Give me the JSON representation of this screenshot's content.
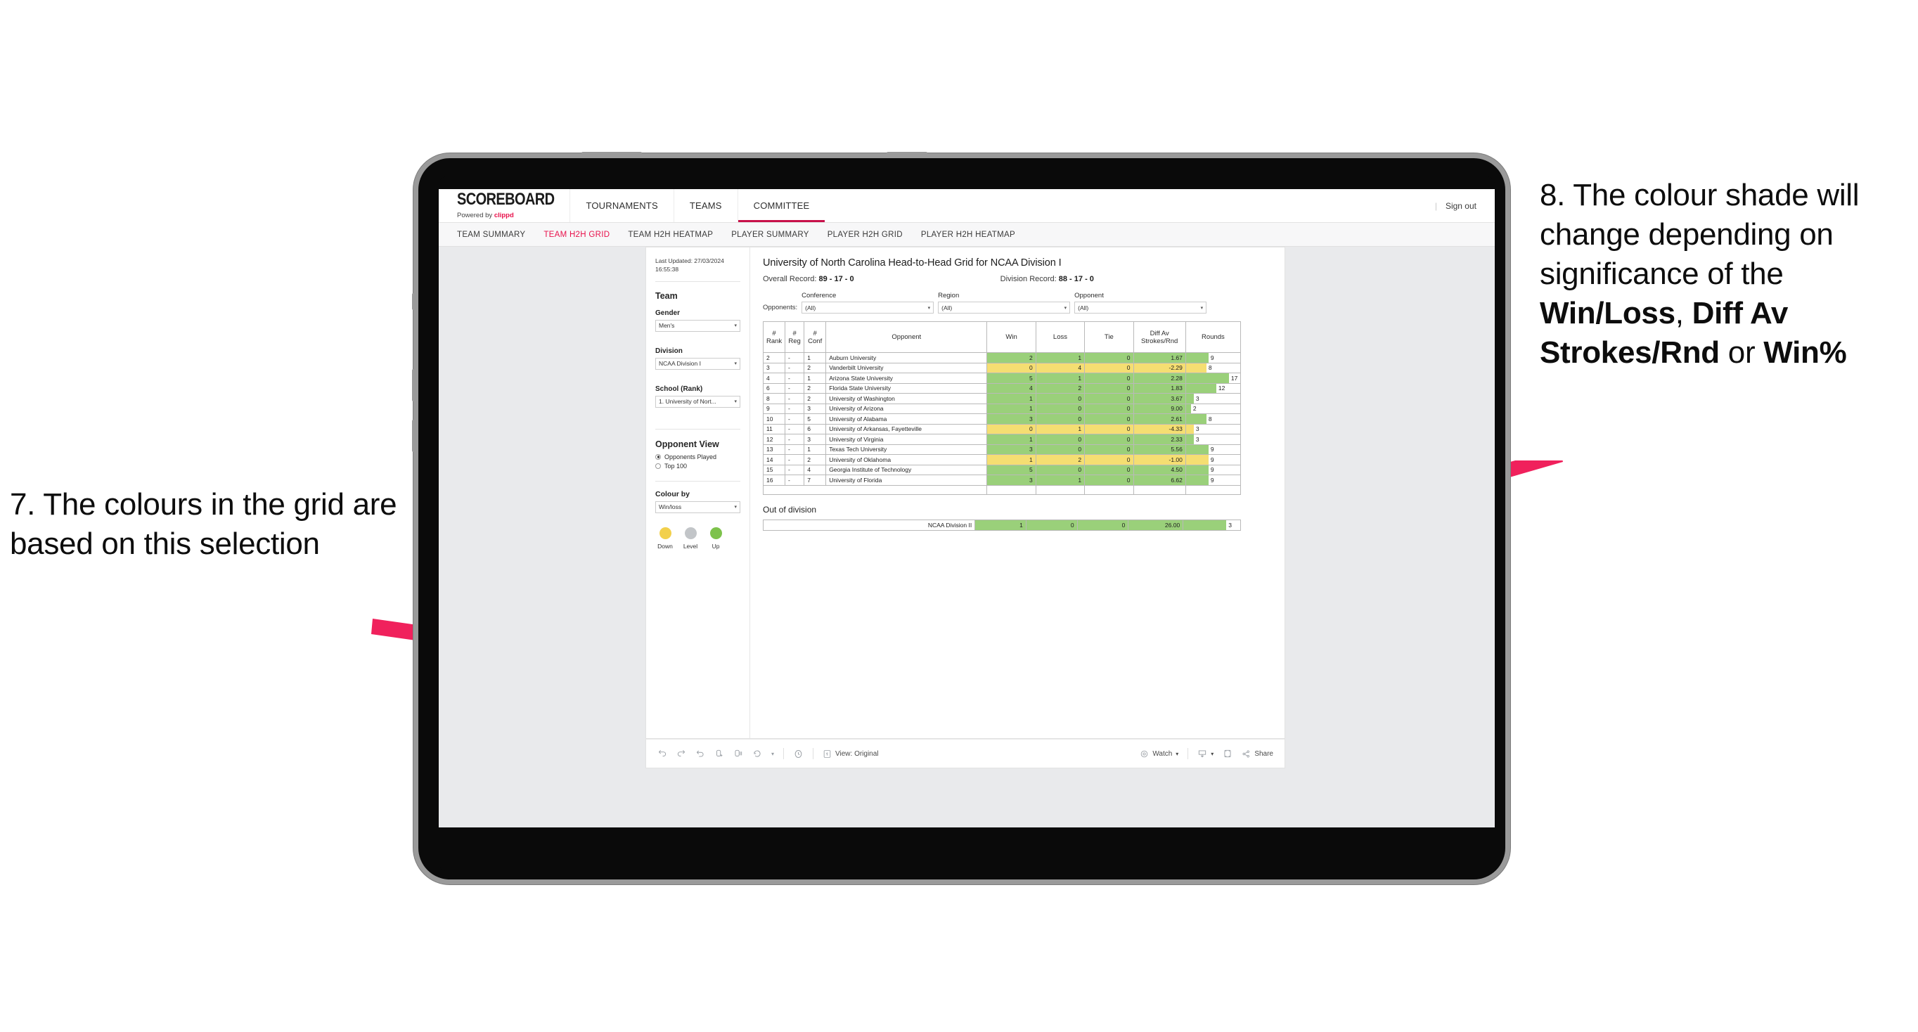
{
  "annotations": {
    "left": "7. The colours in the grid are based on this selection",
    "right_pre": "8. The colour shade will change depending on significance of the ",
    "right_b1": "Win/Loss",
    "right_mid1": ", ",
    "right_b2": "Diff Av Strokes/Rnd",
    "right_mid2": " or ",
    "right_b3": "Win%",
    "arrow_color": "#F0215C"
  },
  "app": {
    "brand": {
      "name": "SCOREBOARD",
      "powered_prefix": "Powered by ",
      "powered_brand": "clippd"
    },
    "topnav": [
      {
        "label": "TOURNAMENTS",
        "active": false
      },
      {
        "label": "TEAMS",
        "active": false
      },
      {
        "label": "COMMITTEE",
        "active": true
      }
    ],
    "topbar_right": {
      "separator": "|",
      "sign_out": "Sign out"
    },
    "subnav": [
      {
        "label": "TEAM SUMMARY",
        "active": false
      },
      {
        "label": "TEAM H2H GRID",
        "active": true
      },
      {
        "label": "TEAM H2H HEATMAP",
        "active": false
      },
      {
        "label": "PLAYER SUMMARY",
        "active": false
      },
      {
        "label": "PLAYER H2H GRID",
        "active": false
      },
      {
        "label": "PLAYER H2H HEATMAP",
        "active": false
      }
    ]
  },
  "sidebar": {
    "last_updated": "Last Updated: 27/03/2024 16:55:38",
    "team_heading": "Team",
    "gender": {
      "label": "Gender",
      "value": "Men's"
    },
    "division": {
      "label": "Division",
      "value": "NCAA Division I"
    },
    "school": {
      "label": "School (Rank)",
      "value": "1. University of Nort..."
    },
    "opponent_view": {
      "heading": "Opponent View",
      "options": [
        {
          "label": "Opponents Played",
          "selected": true
        },
        {
          "label": "Top 100",
          "selected": false
        }
      ]
    },
    "colour_by": {
      "label": "Colour by",
      "value": "Win/loss"
    },
    "legend": [
      {
        "label": "Down",
        "color": "#F2D04B"
      },
      {
        "label": "Level",
        "color": "#C2C5C8"
      },
      {
        "label": "Up",
        "color": "#7DC24B"
      }
    ]
  },
  "viz": {
    "title": "University of North Carolina Head-to-Head Grid for NCAA Division I",
    "overall_record_label": "Overall Record: ",
    "overall_record_value": "89 - 17 - 0",
    "division_record_label": "Division Record: ",
    "division_record_value": "88 - 17 - 0",
    "opponents_label": "Opponents:",
    "filters": [
      {
        "label": "Conference",
        "value": "(All)"
      },
      {
        "label": "Region",
        "value": "(All)"
      },
      {
        "label": "Opponent",
        "value": "(All)"
      }
    ],
    "columns": [
      {
        "l1": "#",
        "l2": "Rank"
      },
      {
        "l1": "#",
        "l2": "Reg"
      },
      {
        "l1": "#",
        "l2": "Conf"
      },
      {
        "l1": "Opponent",
        "l2": ""
      },
      {
        "l1": "Win",
        "l2": ""
      },
      {
        "l1": "Loss",
        "l2": ""
      },
      {
        "l1": "Tie",
        "l2": ""
      },
      {
        "l1": "Diff Av",
        "l2": "Strokes/Rnd"
      },
      {
        "l1": "Rounds",
        "l2": ""
      }
    ],
    "out_of_division_heading": "Out of division",
    "out_of_division": {
      "name": "NCAA Division II",
      "win": "1",
      "loss": "0",
      "tie": "0",
      "diff": "26.00",
      "rounds": "3",
      "rounds_pct": 14,
      "color": "#9AD07A"
    },
    "colors": {
      "up": "#9AD07A",
      "down": "#F5DE72",
      "rounds_bar": "#9AD07A",
      "rounds_bar_down": "#F5DE72"
    }
  },
  "chart_data": {
    "type": "table",
    "title": "University of North Carolina Head-to-Head Grid for NCAA Division I",
    "columns": [
      "# Rank",
      "# Reg",
      "# Conf",
      "Opponent",
      "Win",
      "Loss",
      "Tie",
      "Diff Av Strokes/Rnd",
      "Rounds"
    ],
    "max_rounds": 17,
    "rows": [
      {
        "rank": "2",
        "reg": "-",
        "conf": "1",
        "opponent": "Auburn University",
        "win": "2",
        "loss": "1",
        "tie": "0",
        "diff": "1.67",
        "rounds": 9,
        "state": "up"
      },
      {
        "rank": "3",
        "reg": "-",
        "conf": "2",
        "opponent": "Vanderbilt University",
        "win": "0",
        "loss": "4",
        "tie": "0",
        "diff": "-2.29",
        "rounds": 8,
        "state": "down"
      },
      {
        "rank": "4",
        "reg": "-",
        "conf": "1",
        "opponent": "Arizona State University",
        "win": "5",
        "loss": "1",
        "tie": "0",
        "diff": "2.28",
        "rounds": 17,
        "state": "up"
      },
      {
        "rank": "6",
        "reg": "-",
        "conf": "2",
        "opponent": "Florida State University",
        "win": "4",
        "loss": "2",
        "tie": "0",
        "diff": "1.83",
        "rounds": 12,
        "state": "up"
      },
      {
        "rank": "8",
        "reg": "-",
        "conf": "2",
        "opponent": "University of Washington",
        "win": "1",
        "loss": "0",
        "tie": "0",
        "diff": "3.67",
        "rounds": 3,
        "state": "up"
      },
      {
        "rank": "9",
        "reg": "-",
        "conf": "3",
        "opponent": "University of Arizona",
        "win": "1",
        "loss": "0",
        "tie": "0",
        "diff": "9.00",
        "rounds": 2,
        "state": "up"
      },
      {
        "rank": "10",
        "reg": "-",
        "conf": "5",
        "opponent": "University of Alabama",
        "win": "3",
        "loss": "0",
        "tie": "0",
        "diff": "2.61",
        "rounds": 8,
        "state": "up"
      },
      {
        "rank": "11",
        "reg": "-",
        "conf": "6",
        "opponent": "University of Arkansas, Fayetteville",
        "win": "0",
        "loss": "1",
        "tie": "0",
        "diff": "-4.33",
        "rounds": 3,
        "state": "down"
      },
      {
        "rank": "12",
        "reg": "-",
        "conf": "3",
        "opponent": "University of Virginia",
        "win": "1",
        "loss": "0",
        "tie": "0",
        "diff": "2.33",
        "rounds": 3,
        "state": "up"
      },
      {
        "rank": "13",
        "reg": "-",
        "conf": "1",
        "opponent": "Texas Tech University",
        "win": "3",
        "loss": "0",
        "tie": "0",
        "diff": "5.56",
        "rounds": 9,
        "state": "up"
      },
      {
        "rank": "14",
        "reg": "-",
        "conf": "2",
        "opponent": "University of Oklahoma",
        "win": "1",
        "loss": "2",
        "tie": "0",
        "diff": "-1.00",
        "rounds": 9,
        "state": "down"
      },
      {
        "rank": "15",
        "reg": "-",
        "conf": "4",
        "opponent": "Georgia Institute of Technology",
        "win": "5",
        "loss": "0",
        "tie": "0",
        "diff": "4.50",
        "rounds": 9,
        "state": "up"
      },
      {
        "rank": "16",
        "reg": "-",
        "conf": "7",
        "opponent": "University of Florida",
        "win": "3",
        "loss": "1",
        "tie": "0",
        "diff": "6.62",
        "rounds": 9,
        "state": "up"
      }
    ]
  },
  "toolbar": {
    "view_label": "View: Original",
    "watch_label": "Watch",
    "share_label": "Share",
    "icons": [
      "undo-icon",
      "redo-icon",
      "revert-icon",
      "refresh-icon",
      "pause-icon",
      "zoom-icon",
      "chevron-down-icon",
      "clock-icon",
      "view-icon",
      "watch-icon",
      "download-icon",
      "fullscreen-icon",
      "share-icon"
    ]
  }
}
